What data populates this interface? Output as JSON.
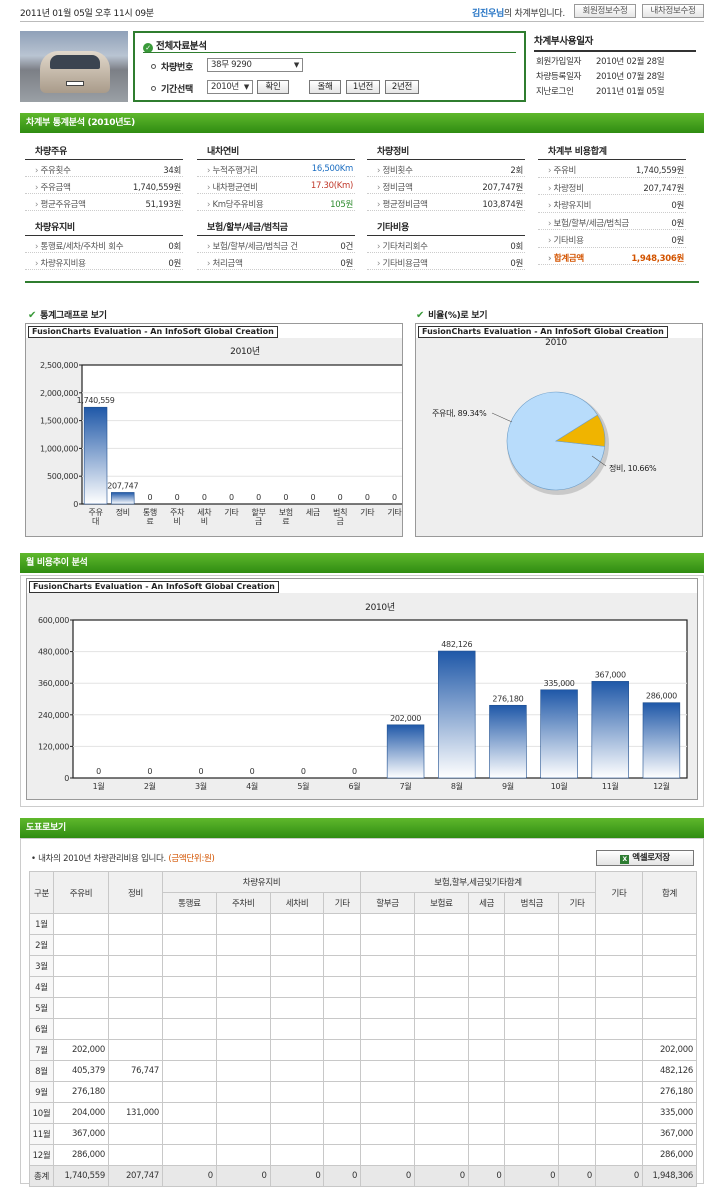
{
  "top": {
    "date": "2011년 01월 05일 오후 11시 09분",
    "welcome_name": "김진우님",
    "welcome_suffix": "의 차계부입니다.",
    "btn_member": "회원정보수정",
    "btn_car": "내차정보수정"
  },
  "select": {
    "title": "전체자료분석",
    "car_label": "차량번호",
    "car_value": "38무 9290",
    "period_label": "기간선택",
    "year_value": "2010년",
    "confirm": "확인",
    "rolling": "올해",
    "one_year": "1년전",
    "two_year": "2년전"
  },
  "userinfo": {
    "title": "차계부사용일자",
    "rows": [
      {
        "k": "회원가입일자",
        "v": "2010년 02월 28일"
      },
      {
        "k": "차량등록일자",
        "v": "2010년 07월 28일"
      },
      {
        "k": "지난로그인",
        "v": "2011년 01월 05일"
      }
    ]
  },
  "stats": {
    "bar_title": "차계부 통계분석 (2010년도)",
    "fuel": {
      "title": "차량주유",
      "rows": [
        {
          "k": "주유횟수",
          "v": "34회"
        },
        {
          "k": "주유금액",
          "v": "1,740,559원"
        },
        {
          "k": "평균주유금액",
          "v": "51,193원"
        }
      ]
    },
    "mileage": {
      "title": "내차연비",
      "rows": [
        {
          "k": "누적주행거리",
          "v": "16,500Km"
        },
        {
          "k": "내차평균연비",
          "v": "17.30(Km)"
        },
        {
          "k": "Km당주유비용",
          "v": "105원"
        }
      ]
    },
    "maint": {
      "title": "차량정비",
      "rows": [
        {
          "k": "정비횟수",
          "v": "2회"
        },
        {
          "k": "정비금액",
          "v": "207,747원"
        },
        {
          "k": "평균정비금액",
          "v": "103,874원"
        }
      ]
    },
    "upkeep": {
      "title": "차량유지비",
      "rows": [
        {
          "k": "통행료/세차/주차비 회수",
          "v": "0회"
        },
        {
          "k": "차량유지비용",
          "v": "0원"
        }
      ]
    },
    "insure": {
      "title": "보험/할부/세금/범칙금",
      "rows": [
        {
          "k": "보험/할부/세금/범칙금 건",
          "v": "0건"
        },
        {
          "k": "처리금액",
          "v": "0원"
        }
      ]
    },
    "other": {
      "title": "기타비용",
      "rows": [
        {
          "k": "기타처리회수",
          "v": "0회"
        },
        {
          "k": "기타비용금액",
          "v": "0원"
        }
      ]
    },
    "total": {
      "title": "차계부 비용합계",
      "rows": [
        {
          "k": "주유비",
          "v": "1,740,559원"
        },
        {
          "k": "차량정비",
          "v": "207,747원"
        },
        {
          "k": "차량유지비",
          "v": "0원"
        },
        {
          "k": "보험/할부/세금/범칙금",
          "v": "0원"
        },
        {
          "k": "기타비용",
          "v": "0원"
        },
        {
          "k": "합계금액",
          "v": "1,948,306원"
        }
      ]
    }
  },
  "graph_title": "통계그래프로 보기",
  "ratio_title": "비율(%)로 보기",
  "fc_label": "FusionCharts Evaluation - An InfoSoft Global Creation",
  "monthly_bar_title": "월 비용추이 분석",
  "table_bar_title": "도표로보기",
  "colors": {
    "green": "#2f8c12",
    "bar_top": "#1f58a8",
    "pie_a": "#b8dcfb",
    "pie_b": "#f0b400"
  },
  "chart_data": [
    {
      "type": "bar",
      "title": "2010년",
      "categories": [
        "주유대",
        "정비",
        "통행료",
        "주차비",
        "세차비",
        "기타",
        "할부금",
        "보험료",
        "세금",
        "범칙금",
        "기타",
        "기타"
      ],
      "values": [
        1740559,
        207747,
        0,
        0,
        0,
        0,
        0,
        0,
        0,
        0,
        0,
        0
      ],
      "labels": [
        "1,740,559",
        "207,747",
        "0",
        "0",
        "0",
        "0",
        "0",
        "0",
        "0",
        "0",
        "0",
        "0"
      ],
      "ylim": [
        0,
        2500000
      ],
      "yticks": [
        "0",
        "500,000",
        "1,000,000",
        "1,500,000",
        "2,000,000",
        "2,500,000"
      ],
      "tickvals": [
        0,
        500000,
        1000000,
        1500000,
        2000000,
        2500000
      ]
    },
    {
      "type": "pie",
      "title": "2010",
      "slices": [
        {
          "name": "주유대",
          "pct": 89.34,
          "label": "주유대, 89.34%"
        },
        {
          "name": "정비",
          "pct": 10.66,
          "label": "정비, 10.66%"
        }
      ]
    },
    {
      "type": "bar",
      "title": "2010년",
      "categories": [
        "1월",
        "2월",
        "3월",
        "4월",
        "5월",
        "6월",
        "7월",
        "8월",
        "9월",
        "10월",
        "11월",
        "12월"
      ],
      "values": [
        0,
        0,
        0,
        0,
        0,
        0,
        202000,
        482126,
        276180,
        335000,
        367000,
        286000
      ],
      "labels": [
        "0",
        "0",
        "0",
        "0",
        "0",
        "0",
        "202,000",
        "482,126",
        "276,180",
        "335,000",
        "367,000",
        "286,000"
      ],
      "ylim": [
        0,
        600000
      ],
      "yticks": [
        "0",
        "120,000",
        "240,000",
        "360,000",
        "480,000",
        "600,000"
      ],
      "tickvals": [
        0,
        120000,
        240000,
        360000,
        480000,
        600000
      ]
    }
  ],
  "table": {
    "caption": "내차의 2010년 차량관리비용 입니다.",
    "unit": "(금액단위:원)",
    "excel": "엑셀로저장",
    "h_gubun": "구분",
    "h_fuel": "주유비",
    "h_maint": "정비",
    "h_upkeep": "차량유지비",
    "h_insure": "보험,할부,세금및기타합계",
    "h_etc": "기타",
    "h_total": "합계",
    "sub": [
      "통행료",
      "주차비",
      "세차비",
      "기타",
      "할부금",
      "보험료",
      "세금",
      "범칙금",
      "기타"
    ],
    "rows": [
      [
        "1월",
        "",
        "",
        "",
        "",
        "",
        "",
        "",
        "",
        "",
        "",
        "",
        "",
        ""
      ],
      [
        "2월",
        "",
        "",
        "",
        "",
        "",
        "",
        "",
        "",
        "",
        "",
        "",
        "",
        ""
      ],
      [
        "3월",
        "",
        "",
        "",
        "",
        "",
        "",
        "",
        "",
        "",
        "",
        "",
        "",
        ""
      ],
      [
        "4월",
        "",
        "",
        "",
        "",
        "",
        "",
        "",
        "",
        "",
        "",
        "",
        "",
        ""
      ],
      [
        "5월",
        "",
        "",
        "",
        "",
        "",
        "",
        "",
        "",
        "",
        "",
        "",
        "",
        ""
      ],
      [
        "6월",
        "",
        "",
        "",
        "",
        "",
        "",
        "",
        "",
        "",
        "",
        "",
        "",
        ""
      ],
      [
        "7월",
        "202,000",
        "",
        "",
        "",
        "",
        "",
        "",
        "",
        "",
        "",
        "",
        "",
        "202,000"
      ],
      [
        "8월",
        "405,379",
        "76,747",
        "",
        "",
        "",
        "",
        "",
        "",
        "",
        "",
        "",
        "",
        "482,126"
      ],
      [
        "9월",
        "276,180",
        "",
        "",
        "",
        "",
        "",
        "",
        "",
        "",
        "",
        "",
        "",
        "276,180"
      ],
      [
        "10월",
        "204,000",
        "131,000",
        "",
        "",
        "",
        "",
        "",
        "",
        "",
        "",
        "",
        "",
        "335,000"
      ],
      [
        "11월",
        "367,000",
        "",
        "",
        "",
        "",
        "",
        "",
        "",
        "",
        "",
        "",
        "",
        "367,000"
      ],
      [
        "12월",
        "286,000",
        "",
        "",
        "",
        "",
        "",
        "",
        "",
        "",
        "",
        "",
        "",
        "286,000"
      ],
      [
        "총계",
        "1,740,559",
        "207,747",
        "0",
        "0",
        "0",
        "0",
        "0",
        "0",
        "0",
        "0",
        "0",
        "0",
        "1,948,306"
      ]
    ]
  }
}
